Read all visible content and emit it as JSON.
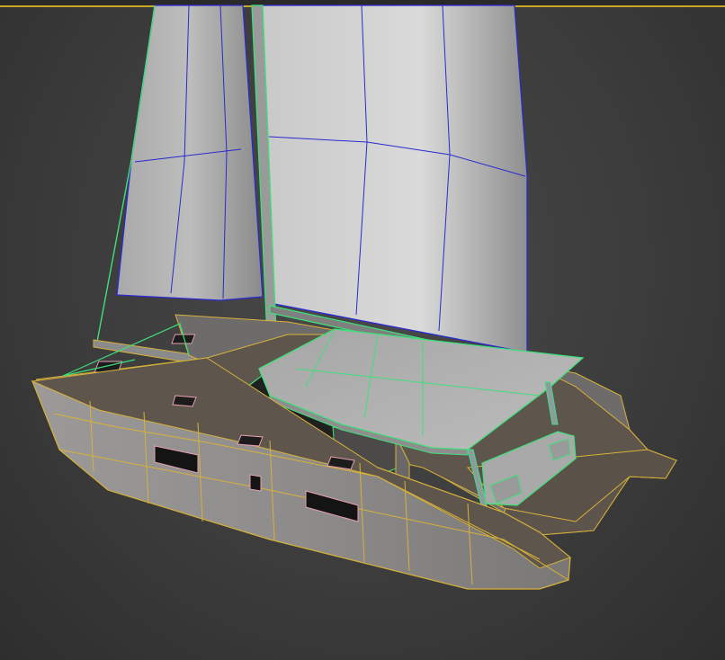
{
  "viewport": {
    "active_border_color": "#c9a826",
    "background_color": "#3c3c3c"
  },
  "colors": {
    "hull_wire": "#d8b13a",
    "deck_wire": "#d8b13a",
    "sail_wire": "#2a2ad0",
    "selection_wire": "#3ee07a",
    "window_outline": "#e8a0b0"
  },
  "scene": {
    "object": "catamaran-sailboat-model",
    "parts": [
      "mainsail",
      "jib",
      "mast",
      "boom",
      "hardtop",
      "hull-port",
      "hull-starboard",
      "deck",
      "rear-bench",
      "crossbeam"
    ]
  }
}
